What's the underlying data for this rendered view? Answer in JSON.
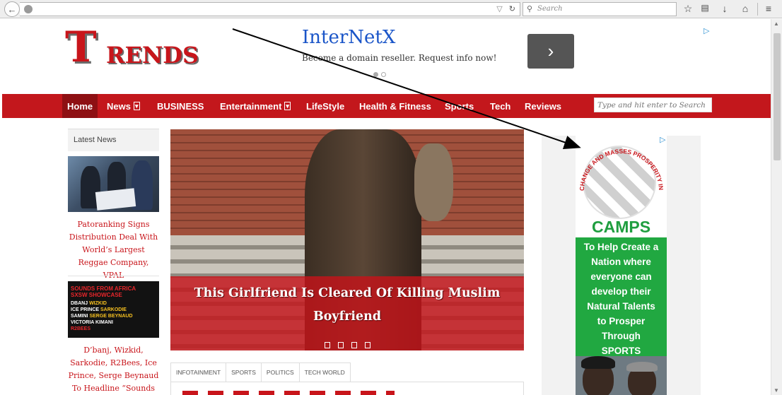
{
  "browser": {
    "url": "",
    "search_placeholder": "Search",
    "icons": [
      "back-arrow-icon",
      "globe-icon",
      "dropdown-icon",
      "reload-icon",
      "search-icon",
      "star-icon",
      "reading-list-icon",
      "download-icon",
      "home-icon",
      "menu-icon"
    ]
  },
  "header": {
    "logo_initial": "T",
    "logo_rest": "RENDS",
    "ad": {
      "title": "InterNetX",
      "subtitle": "Become a domain reseller. Request info now!",
      "next_label": "›"
    }
  },
  "nav": {
    "items": [
      {
        "label": "Home",
        "active": true
      },
      {
        "label": "News",
        "dropdown": true
      },
      {
        "label": "BUSINESS"
      },
      {
        "label": "Entertainment",
        "dropdown": true
      },
      {
        "label": "LifeStyle"
      },
      {
        "label": "Health & Fitness"
      },
      {
        "label": "Sports"
      },
      {
        "label": "Tech"
      },
      {
        "label": "Reviews"
      }
    ],
    "search_placeholder": "Type and hit enter to Search"
  },
  "latest_news": {
    "heading": "Latest News",
    "items": [
      {
        "title": "Patoranking Signs Distribution Deal With World’s Largest Reggae Company, VPAL"
      },
      {
        "title": "D’banj, Wizkid, Sarkodie, R2Bees, Ice Prince, Serge Beynaud To Headline “Sounds from Africa” @"
      }
    ],
    "thumb2_text": {
      "line1": "SOUNDS FROM AFRICA",
      "line2": "SXSW SHOWCASE",
      "line3a": "DBANJ",
      "line3b": "WIZKID",
      "line4a": "ICE PRINCE",
      "line4b": "SARKODIE",
      "line5a": "SAMINI",
      "line5b": "SERGE BEYNAUD",
      "line6": "VICTORIA KIMANI",
      "line7": "R2BEES"
    }
  },
  "hero": {
    "title": "This Girlfriend Is Cleared Of Killing Muslim Boyfriend",
    "slide_count": 4
  },
  "tabs": [
    {
      "label": "INFOTAINMENT",
      "active": true
    },
    {
      "label": "SPORTS"
    },
    {
      "label": "POLITICS"
    },
    {
      "label": "TECH WORLD"
    }
  ],
  "sidebar_ad": {
    "arc_text": "CHANGE AND MASSES PROSPERITY IN SPORTS",
    "name": "CAMPS",
    "message_lines": [
      "To Help Create a",
      "Nation where",
      "everyone can",
      "develop their",
      "Natural Talents",
      "to Prosper",
      "Through",
      "SPORTS"
    ]
  },
  "colors": {
    "brand_red": "#c3171c",
    "nav_active": "#8e1013",
    "link_red": "#c8151b",
    "camps_green": "#21a841",
    "ad_blue": "#1a55c8"
  }
}
